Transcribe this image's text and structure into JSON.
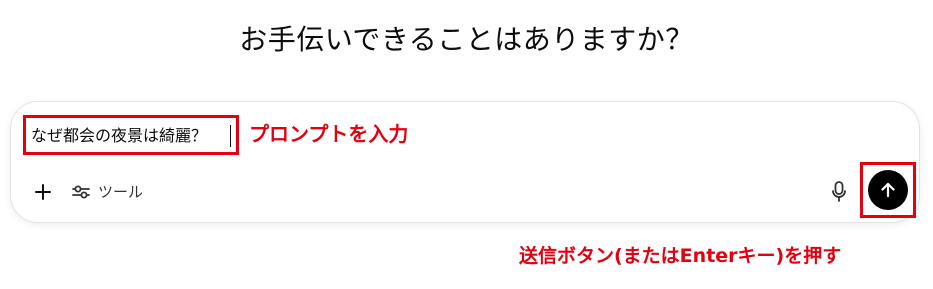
{
  "heading": "お手伝いできることはありますか？",
  "composer": {
    "prompt_value": "なぜ都会の夜景は綺麗？",
    "tools_label": "ツール",
    "icons": {
      "add": "plus-icon",
      "tools": "sliders-icon",
      "voice": "microphone-icon",
      "send": "arrow-up-icon"
    }
  },
  "annotations": {
    "prompt": "プロンプトを入力",
    "send": "送信ボタン(またはEnterキー)を押す"
  },
  "colors": {
    "annotation_red": "#e4000f",
    "send_button": "#000000",
    "border": "#e3e3e3"
  }
}
